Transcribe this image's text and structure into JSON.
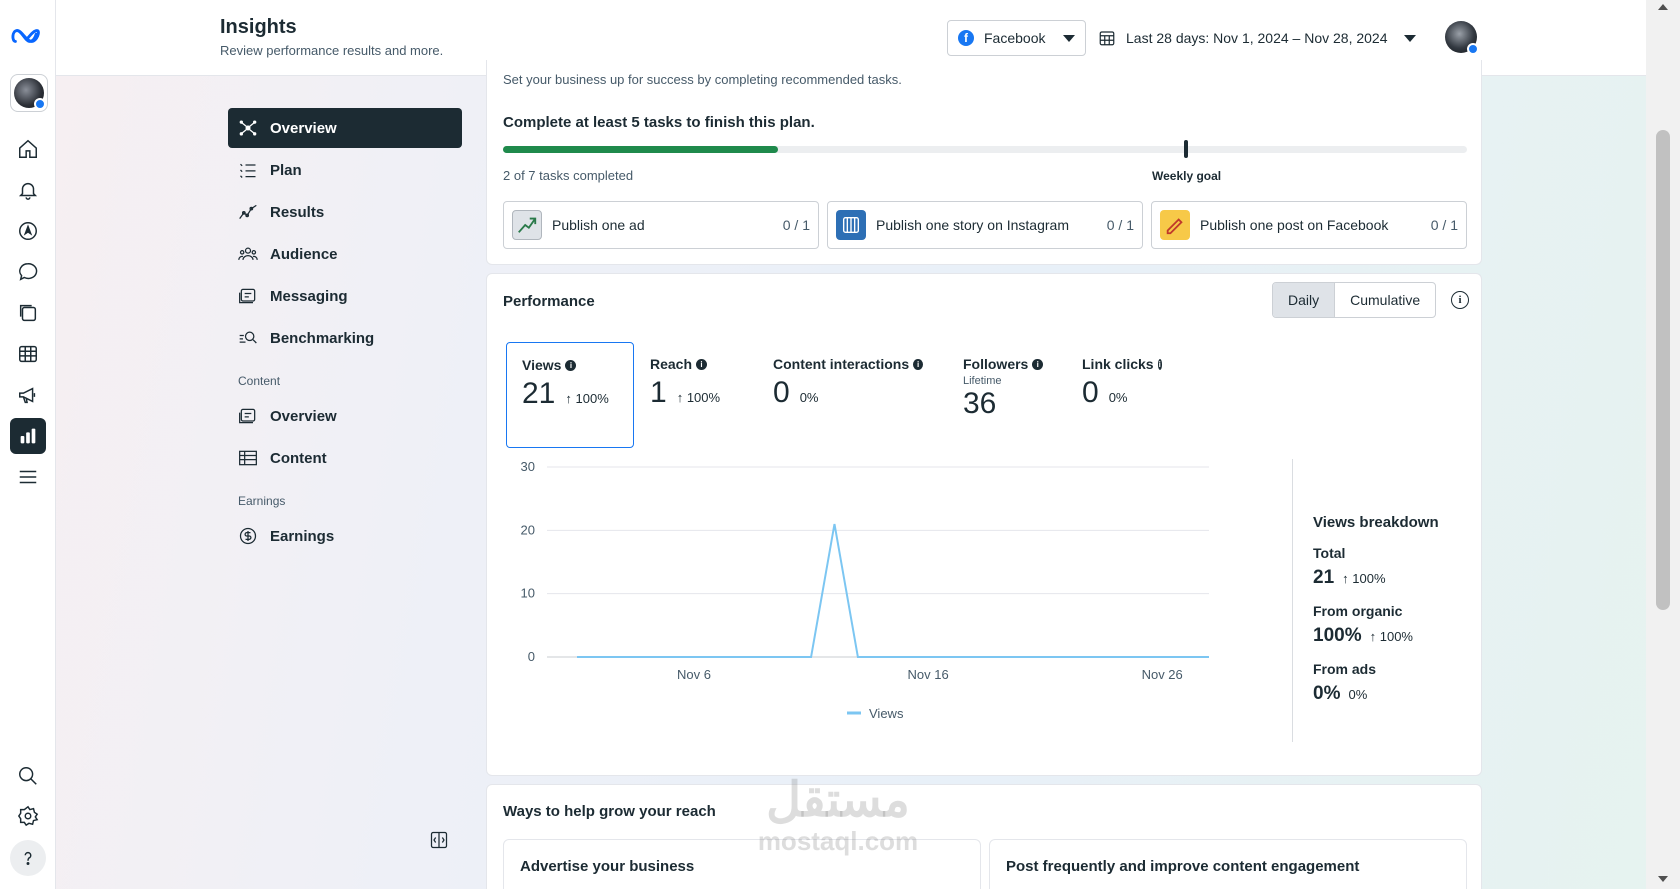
{
  "header": {
    "title": "Insights",
    "subtitle": "Review performance results and more.",
    "platform": "Facebook",
    "date_range": "Last 28 days: Nov 1, 2024 – Nov 28, 2024"
  },
  "subnav": {
    "items": [
      {
        "label": "Overview"
      },
      {
        "label": "Plan"
      },
      {
        "label": "Results"
      },
      {
        "label": "Audience"
      },
      {
        "label": "Messaging"
      },
      {
        "label": "Benchmarking"
      }
    ],
    "content_section": "Content",
    "content_items": [
      {
        "label": "Overview"
      },
      {
        "label": "Content"
      }
    ],
    "earnings_section": "Earnings",
    "earnings_items": [
      {
        "label": "Earnings"
      }
    ]
  },
  "plan": {
    "intro": "Set your business up for success by completing recommended tasks.",
    "title": "Complete at least 5 tasks to finish this plan.",
    "progress_fraction": 0.2857,
    "tasks_completed": "2 of 7 tasks completed",
    "goal_label": "Weekly goal",
    "tasks": [
      {
        "label": "Publish one ad",
        "count": "0 / 1"
      },
      {
        "label": "Publish one story on Instagram",
        "count": "0 / 1"
      },
      {
        "label": "Publish one post on Facebook",
        "count": "0 / 1"
      }
    ]
  },
  "performance": {
    "title": "Performance",
    "toggle": {
      "daily": "Daily",
      "cumulative": "Cumulative"
    },
    "metrics": [
      {
        "label": "Views",
        "value": "21",
        "change": "100%",
        "sub": ""
      },
      {
        "label": "Reach",
        "value": "1",
        "change": "100%",
        "sub": ""
      },
      {
        "label": "Content interactions",
        "value": "0",
        "change": "0%",
        "sub": ""
      },
      {
        "label": "Followers",
        "value": "36",
        "change": "",
        "sub": "Lifetime"
      },
      {
        "label": "Link clicks",
        "value": "0",
        "change": "0%",
        "sub": ""
      }
    ],
    "breakdown": {
      "title": "Views breakdown",
      "total_label": "Total",
      "total_value": "21",
      "total_change": "100%",
      "organic_label": "From organic",
      "organic_value": "100%",
      "organic_change": "100%",
      "ads_label": "From ads",
      "ads_value": "0%",
      "ads_change": "0%"
    }
  },
  "chart_data": {
    "type": "line",
    "x": [
      "Nov 1",
      "Nov 2",
      "Nov 3",
      "Nov 4",
      "Nov 5",
      "Nov 6",
      "Nov 7",
      "Nov 8",
      "Nov 9",
      "Nov 10",
      "Nov 11",
      "Nov 12",
      "Nov 13",
      "Nov 14",
      "Nov 15",
      "Nov 16",
      "Nov 17",
      "Nov 18",
      "Nov 19",
      "Nov 20",
      "Nov 21",
      "Nov 22",
      "Nov 23",
      "Nov 24",
      "Nov 25",
      "Nov 26",
      "Nov 27",
      "Nov 28"
    ],
    "x_tick_labels": [
      "Nov 6",
      "Nov 16",
      "Nov 26"
    ],
    "series": [
      {
        "name": "Views",
        "color": "#7cc6f2",
        "values": [
          0,
          0,
          0,
          0,
          0,
          0,
          0,
          0,
          0,
          0,
          0,
          21,
          0,
          0,
          0,
          0,
          0,
          0,
          0,
          0,
          0,
          0,
          0,
          0,
          0,
          0,
          0,
          0
        ]
      }
    ],
    "y_ticks": [
      0,
      10,
      20,
      30
    ],
    "ylim": [
      0,
      30
    ],
    "grid": true,
    "legend": "bottom"
  },
  "grow": {
    "title": "Ways to help grow your reach",
    "cards": [
      {
        "title": "Advertise your business"
      },
      {
        "title": "Post frequently and improve content engagement"
      }
    ]
  },
  "watermark": {
    "arabic": "مستقل",
    "latin": "mostaql.com"
  },
  "colors": {
    "accent": "#1877f2",
    "progress": "#1f8a4c",
    "nav_active": "#1c2b33",
    "chart_line": "#7cc6f2"
  }
}
